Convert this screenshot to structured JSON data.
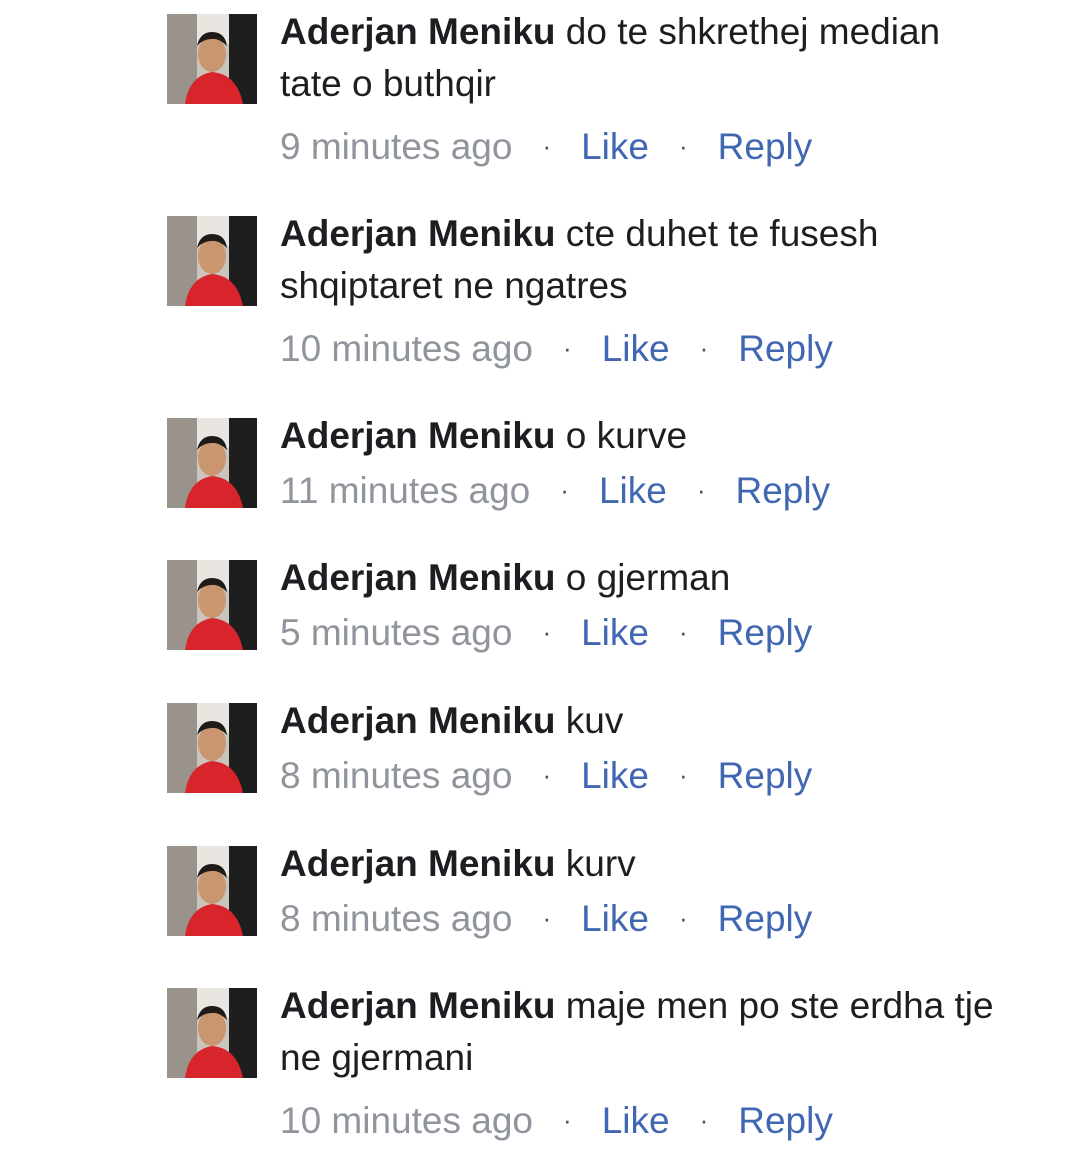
{
  "colors": {
    "text": "#1c1e21",
    "meta": "#90949c",
    "link": "#4267b2"
  },
  "separator": "·",
  "comments": [
    {
      "author": "Aderjan Meniku",
      "text": "do te shkrethej  median tate o buthqir",
      "time": "9 minutes ago",
      "like": "Like",
      "reply": "Reply"
    },
    {
      "author": "Aderjan Meniku",
      "text": "cte duhet te fusesh shqiptaret ne ngatres",
      "time": "10 minutes ago",
      "like": "Like",
      "reply": "Reply"
    },
    {
      "author": "Aderjan Meniku",
      "text": "o kurve",
      "time": "11 minutes ago",
      "like": "Like",
      "reply": "Reply"
    },
    {
      "author": "Aderjan Meniku",
      "text": "o gjerman",
      "time": "5 minutes ago",
      "like": "Like",
      "reply": "Reply"
    },
    {
      "author": "Aderjan Meniku",
      "text": "kuv",
      "time": "8 minutes ago",
      "like": "Like",
      "reply": "Reply"
    },
    {
      "author": "Aderjan Meniku",
      "text": "kurv",
      "time": "8 minutes ago",
      "like": "Like",
      "reply": "Reply"
    },
    {
      "author": "Aderjan Meniku",
      "text": "maje men po ste erdha tje ne gjermani",
      "time": "10 minutes ago",
      "like": "Like",
      "reply": "Reply"
    }
  ]
}
